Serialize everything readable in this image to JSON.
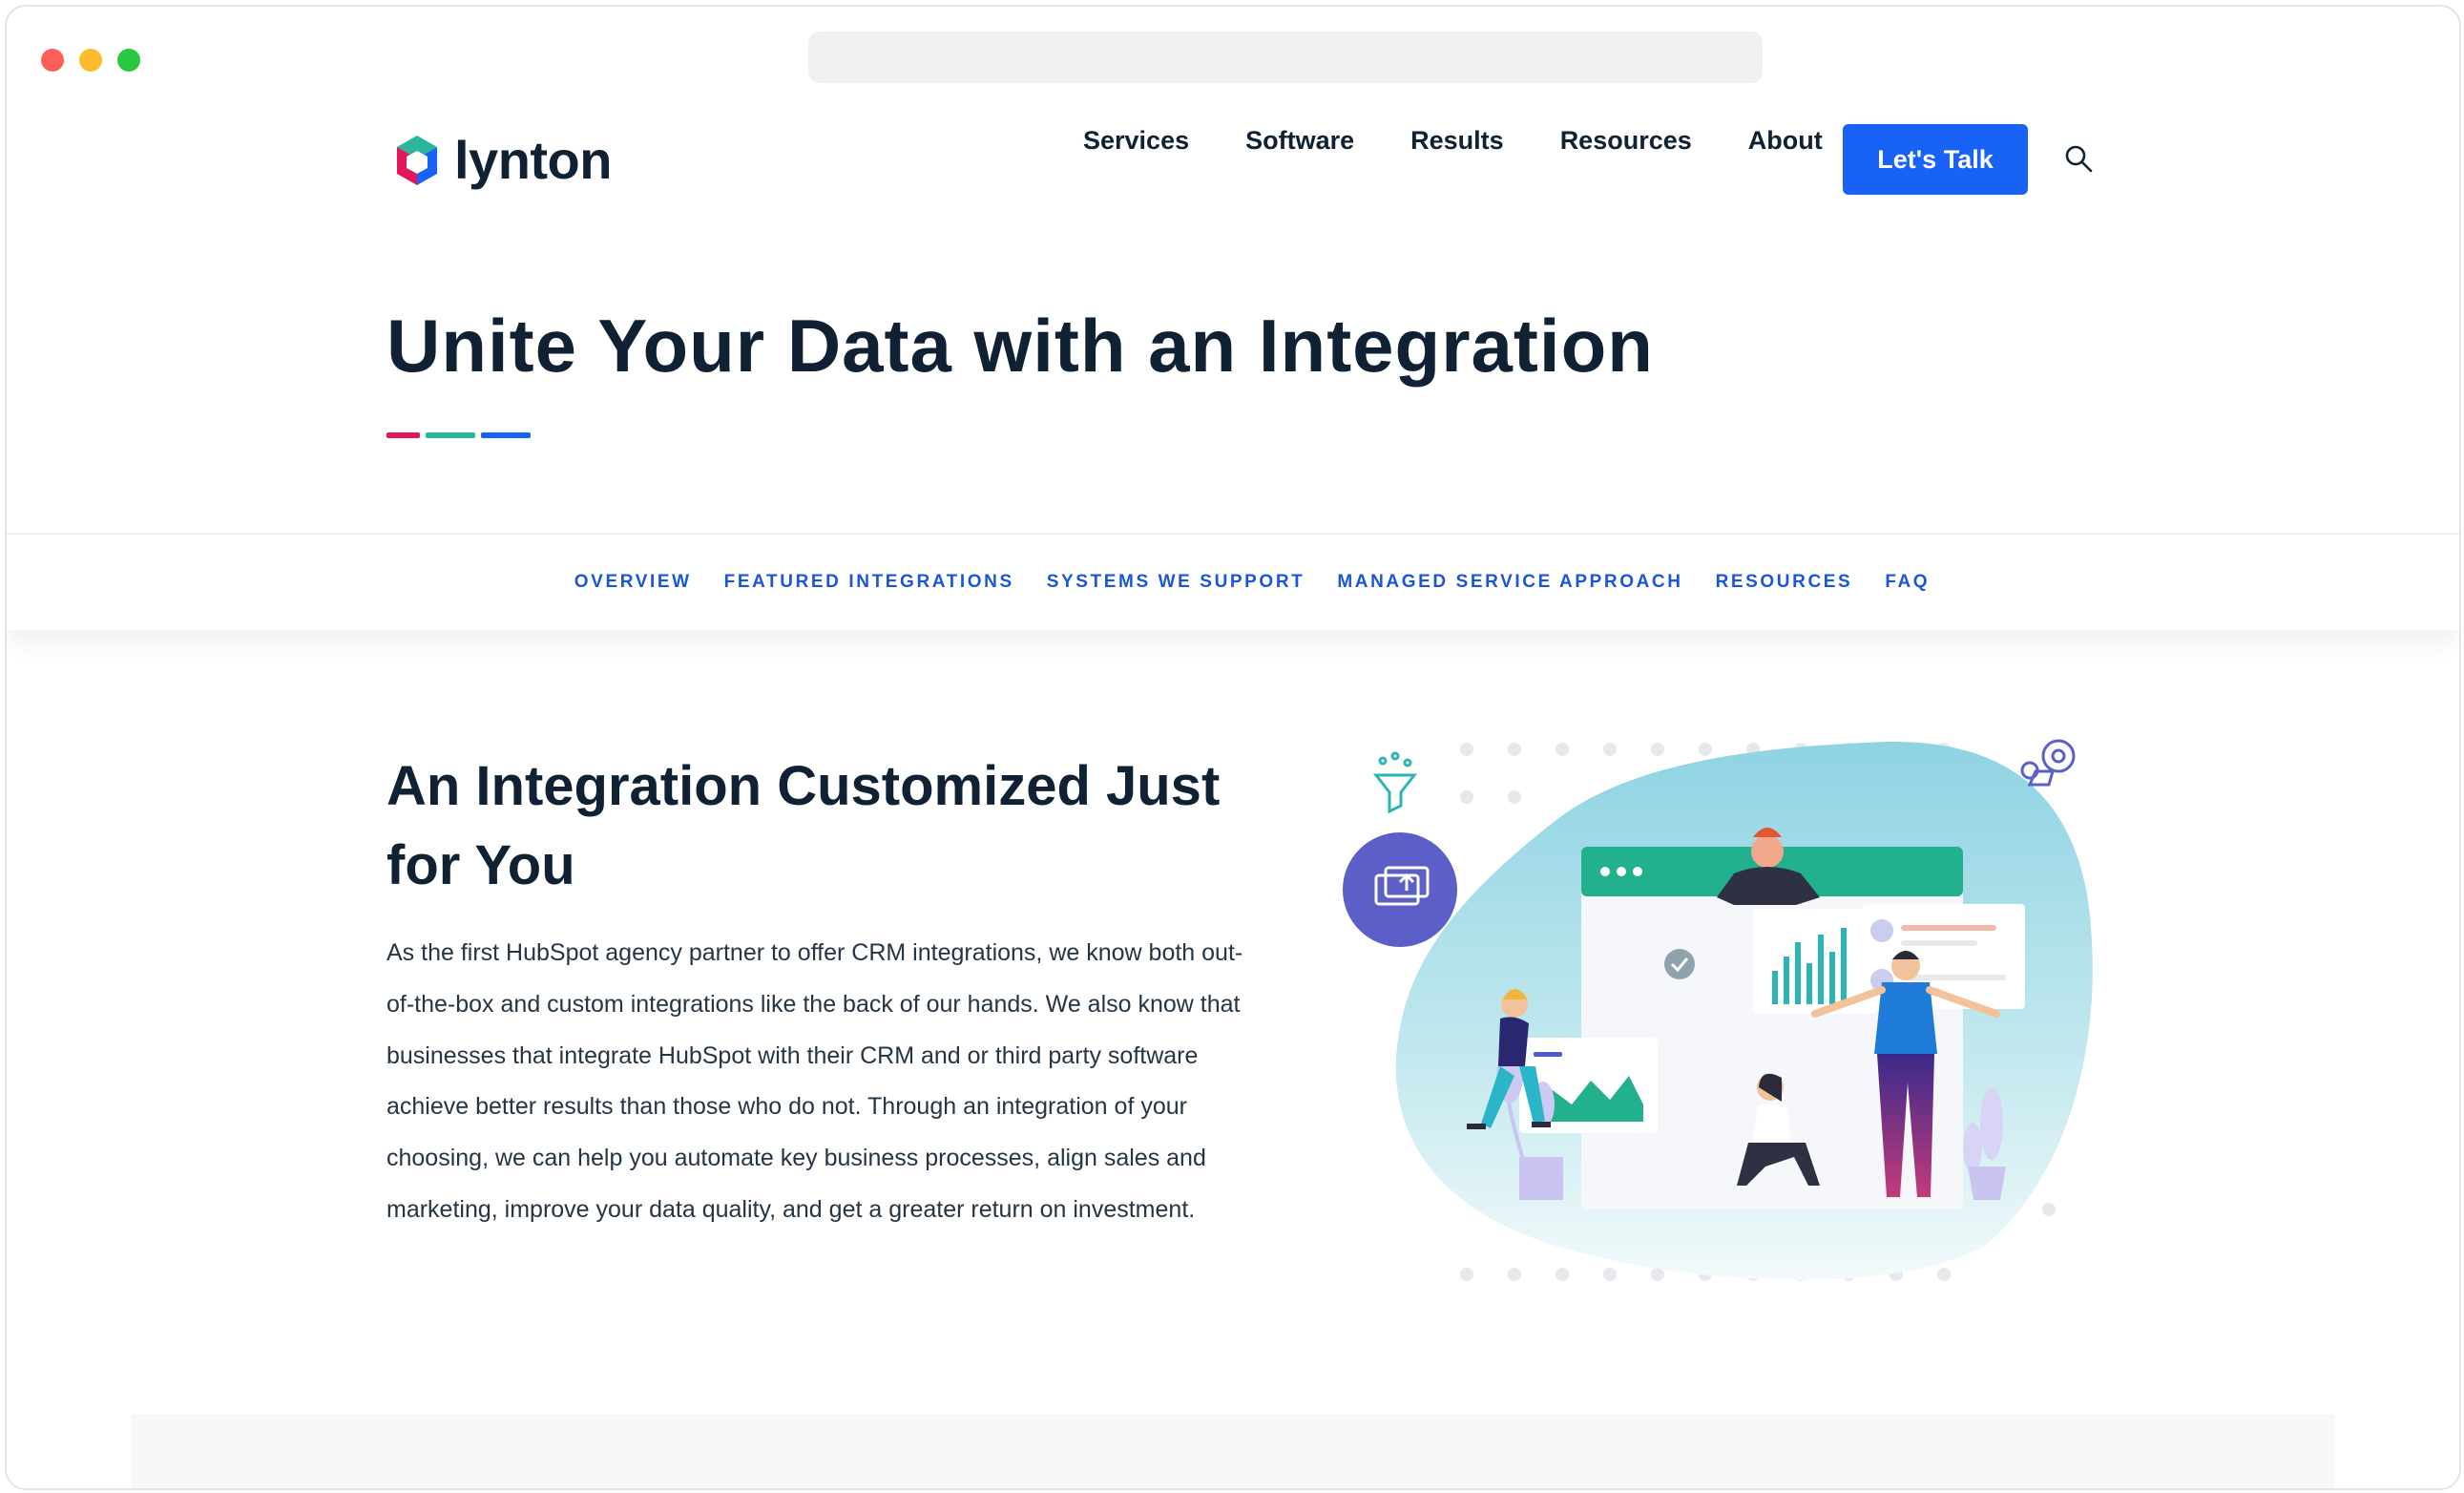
{
  "browser": {
    "dots": [
      "#fc5f57",
      "#fdbc2e",
      "#28c840"
    ]
  },
  "header": {
    "logo_text": "lynton",
    "nav": [
      "Services",
      "Software",
      "Results",
      "Resources",
      "About"
    ],
    "cta_label": "Let's Talk",
    "search_icon": "search-icon"
  },
  "hero": {
    "title": "Unite Your Data with an Integration",
    "accent_colors": [
      "#e2185a",
      "#2bb59a",
      "#1962f6"
    ]
  },
  "subnav": {
    "links": [
      "OVERVIEW",
      "FEATURED INTEGRATIONS",
      "SYSTEMS WE SUPPORT",
      "MANAGED SERVICE APPROACH",
      "RESOURCES",
      "FAQ"
    ]
  },
  "section": {
    "title": "An Integration Customized Just for You",
    "body": "As the first HubSpot agency partner to offer CRM integrations, we know both out-of-the-box and custom integrations like the back of our hands. We also know that businesses that integrate HubSpot with their CRM and or third party software achieve better results than those who do not. Through an integration of your choosing, we can help you automate key business processes, align sales and marketing, improve your data quality, and get a greater return on investment."
  },
  "colors": {
    "brand_blue": "#1962f6",
    "link_blue": "#1b56d6",
    "heading": "#0f2133",
    "teal": "#2bb59a",
    "illustration_purple": "#5b5fc7"
  }
}
